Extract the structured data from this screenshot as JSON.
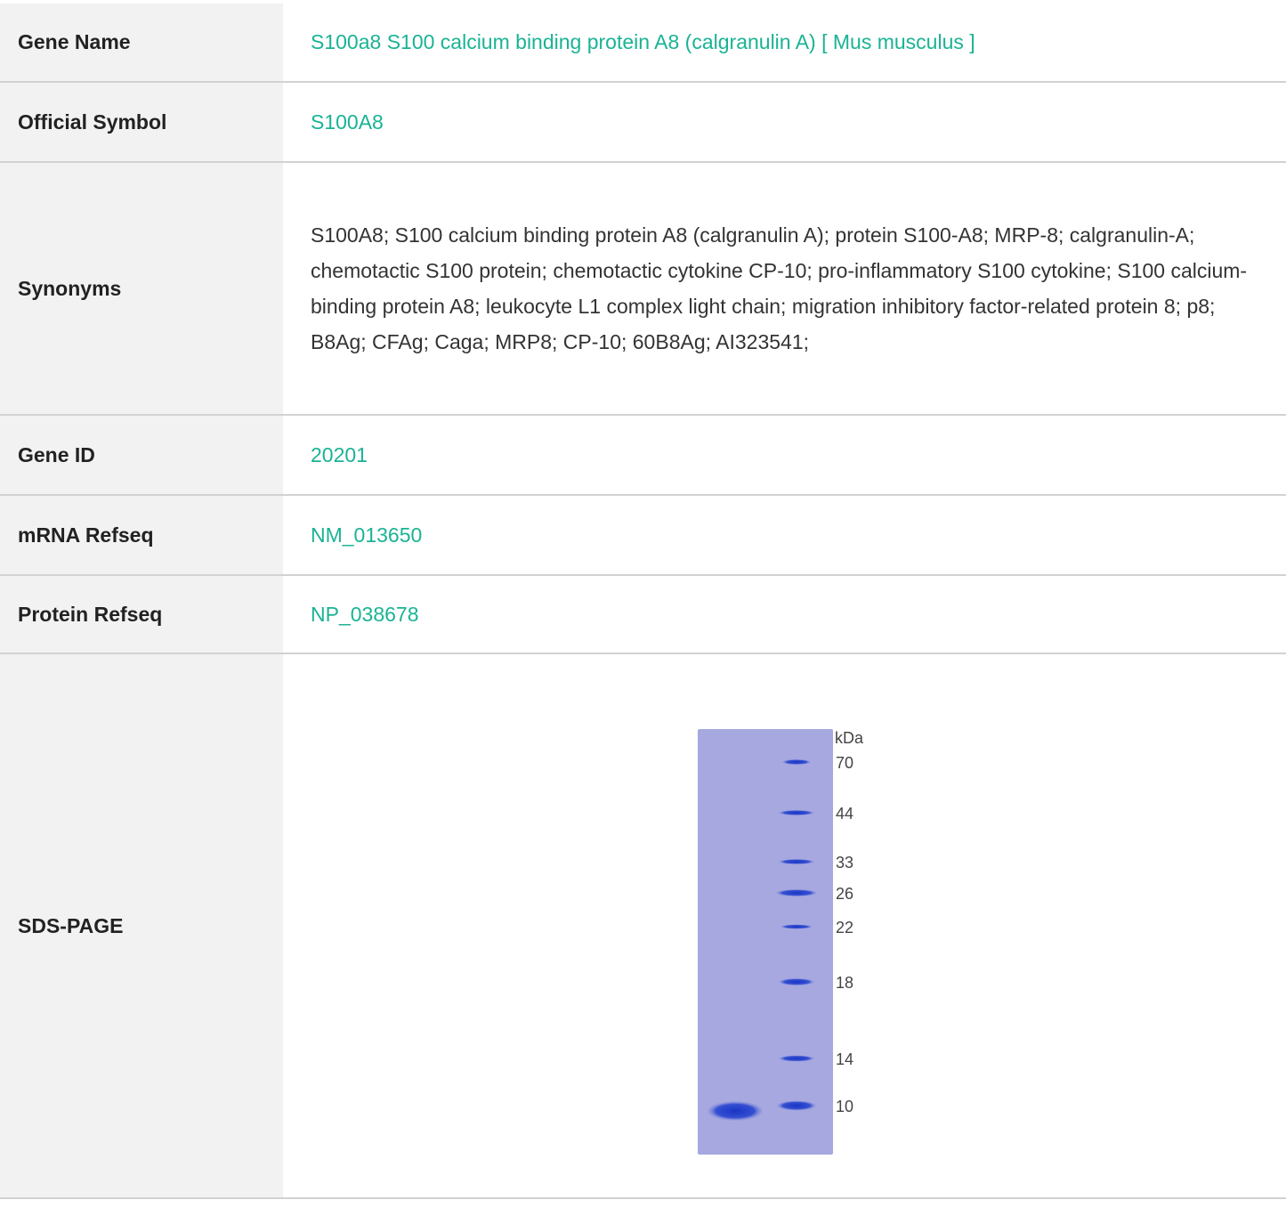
{
  "rows": {
    "gene_name": {
      "label": "Gene Name",
      "value": "S100a8 S100 calcium binding protein A8 (calgranulin A) [ Mus musculus ]"
    },
    "official_symbol": {
      "label": "Official Symbol",
      "value": "S100A8"
    },
    "synonyms": {
      "label": "Synonyms",
      "value": "S100A8; S100 calcium binding protein A8 (calgranulin A); protein S100-A8; MRP-8; calgranulin-A; chemotactic S100 protein; chemotactic cytokine CP-10; pro-inflammatory S100 cytokine; S100 calcium-binding protein A8; leukocyte L1 complex light chain; migration inhibitory factor-related protein 8; p8; B8Ag; CFAg; Caga; MRP8; CP-10; 60B8Ag; AI323541;"
    },
    "gene_id": {
      "label": "Gene ID",
      "value": "20201"
    },
    "mrna_refseq": {
      "label": "mRNA Refseq",
      "value": "NM_013650"
    },
    "protein_refseq": {
      "label": "Protein Refseq",
      "value": "NP_038678"
    },
    "sds_page": {
      "label": "SDS-PAGE"
    }
  },
  "gel": {
    "unit_label": "kDa",
    "markers": [
      "70",
      "44",
      "33",
      "26",
      "22",
      "18",
      "14",
      "10"
    ],
    "colors": {
      "gel": "#a6a8df",
      "band": "#2a42c8",
      "text": "#444444"
    }
  },
  "colors": {
    "link": "#1ab394",
    "label_bg": "#f2f2f2",
    "border": "#d2d2d2"
  }
}
